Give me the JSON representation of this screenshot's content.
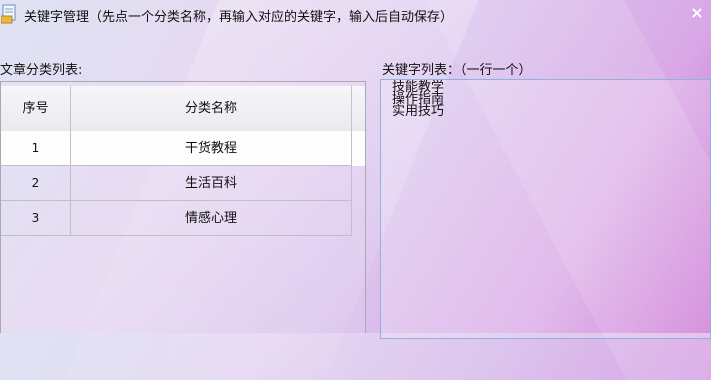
{
  "window": {
    "title": "关键字管理（先点一个分类名称，再输入对应的关键字，输入后自动保存）",
    "close_glyph": "×"
  },
  "categories": {
    "label": "文章分类列表:",
    "columns": [
      "序号",
      "分类名称"
    ],
    "rows": [
      {
        "no": "1",
        "name": "干货教程",
        "selected": true
      },
      {
        "no": "2",
        "name": "生活百科",
        "selected": false
      },
      {
        "no": "3",
        "name": "情感心理",
        "selected": false
      }
    ]
  },
  "keywords": {
    "label": "关键字列表：（一行一个）",
    "value": "技能教学\n操作指南\n实用技巧"
  }
}
